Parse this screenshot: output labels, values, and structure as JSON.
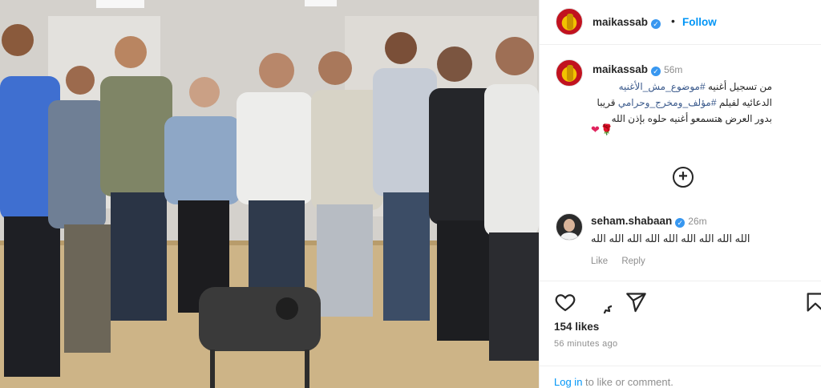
{
  "post": {
    "username": "maikassab",
    "follow_label": "Follow",
    "separator": "•"
  },
  "caption": {
    "username": "maikassab",
    "time": "56m",
    "line1_text": "من تسجيل أغنيه ",
    "line1_tag": "#موضوع_مش_الأغنيه",
    "line2_text": "الدعائيه لفيلم ",
    "line2_tag": "#مؤلف_ومخرج_وحرامي",
    "line2_end": " قريبا",
    "line3": "بدور العرض هتسمعو أغنيه حلوه بإذن الله",
    "hearts": "❤🌹"
  },
  "more_comments_label": "+",
  "comment": {
    "username": "seham.shabaan",
    "time": "26m",
    "text": "الله الله الله الله الله الله الله الله الله",
    "like_label": "Like",
    "reply_label": "Reply"
  },
  "icons": {
    "like": "heart-icon",
    "comment": "comment-icon",
    "share": "share-icon",
    "save": "bookmark-icon"
  },
  "likes_text": "154 likes",
  "time_ago": "56 minutes ago",
  "login": {
    "link_label": "Log in",
    "rest": " to like or comment."
  }
}
